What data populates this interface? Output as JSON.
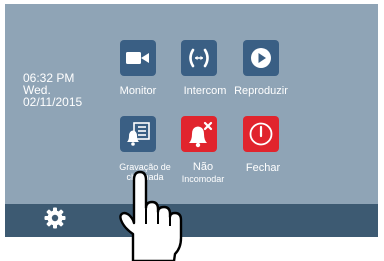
{
  "clock": {
    "time": "06:32 PM",
    "day": "Wed.",
    "date": "02/11/2015"
  },
  "tiles": [
    {
      "label": "Monitor",
      "icon": "camera-icon",
      "color": "#3a5f84"
    },
    {
      "label": "Intercom",
      "icon": "intercom-icon",
      "color": "#3a5f84"
    },
    {
      "label": "Reproduzir",
      "icon": "play-icon",
      "color": "#3a5f84"
    },
    {
      "label_line1": "Gravação de",
      "label_line2": "chamada",
      "icon": "call-recording-icon",
      "color": "#3a5f84"
    },
    {
      "label_line1": "Não",
      "label_line2": "Incomodar",
      "icon": "do-not-disturb-icon",
      "color": "#e1242d"
    },
    {
      "label": "Fechar",
      "icon": "close-power-icon",
      "color": "#e1242d"
    }
  ],
  "footer": {
    "settings_icon": "gear-icon"
  },
  "overlay": {
    "icon": "pointing-hand-icon"
  },
  "colors": {
    "screen_bg": "#8fa4b6",
    "footer_bg": "#3d5a72",
    "tile_blue": "#3a5f84",
    "tile_red": "#e1242d"
  }
}
